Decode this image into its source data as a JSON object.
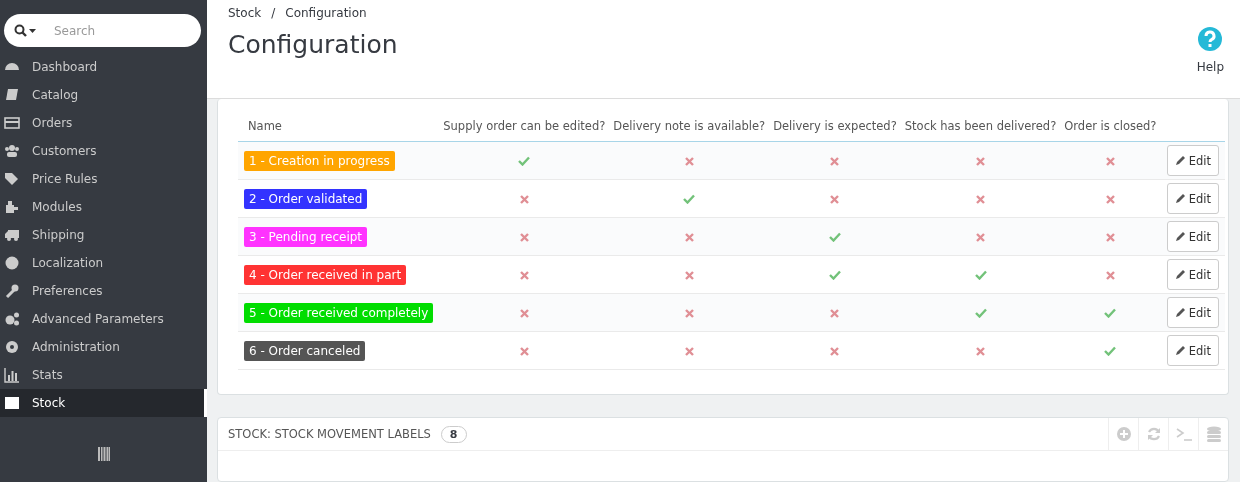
{
  "sidebar": {
    "search": {
      "placeholder": "Search"
    },
    "items": [
      {
        "label": "Dashboard",
        "selected": false
      },
      {
        "label": "Catalog",
        "selected": false
      },
      {
        "label": "Orders",
        "selected": false
      },
      {
        "label": "Customers",
        "selected": false
      },
      {
        "label": "Price Rules",
        "selected": false
      },
      {
        "label": "Modules",
        "selected": false
      },
      {
        "label": "Shipping",
        "selected": false
      },
      {
        "label": "Localization",
        "selected": false
      },
      {
        "label": "Preferences",
        "selected": false
      },
      {
        "label": "Advanced Parameters",
        "selected": false
      },
      {
        "label": "Administration",
        "selected": false
      },
      {
        "label": "Stats",
        "selected": false
      },
      {
        "label": "Stock",
        "selected": true
      }
    ]
  },
  "breadcrumb": [
    "Stock",
    "/",
    "Configuration"
  ],
  "page_title": "Configuration",
  "help": {
    "label": "Help"
  },
  "table": {
    "columns": [
      "Name",
      "Supply order can be edited?",
      "Delivery note is available?",
      "Delivery is expected?",
      "Stock has been delivered?",
      "Order is closed?"
    ],
    "rows": [
      {
        "name": "1 - Creation in progress",
        "color": "#ffa500",
        "values": [
          true,
          false,
          false,
          false,
          false
        ],
        "action": "Edit"
      },
      {
        "name": "2 - Order validated",
        "color": "#3333ff",
        "values": [
          false,
          true,
          false,
          false,
          false
        ],
        "action": "Edit"
      },
      {
        "name": "3 - Pending receipt",
        "color": "#ff33ff",
        "values": [
          false,
          false,
          true,
          false,
          false
        ],
        "action": "Edit"
      },
      {
        "name": "4 - Order received in part",
        "color": "#ff3333",
        "values": [
          false,
          false,
          true,
          true,
          false
        ],
        "action": "Edit"
      },
      {
        "name": "5 - Order received completely",
        "color": "#00dd00",
        "values": [
          false,
          false,
          false,
          true,
          true
        ],
        "action": "Edit"
      },
      {
        "name": "6 - Order canceled",
        "color": "#555555",
        "values": [
          false,
          false,
          false,
          false,
          true
        ],
        "action": "Edit"
      }
    ]
  },
  "movement_panel": {
    "title": "STOCK: STOCK MOVEMENT LABELS",
    "count": "8"
  }
}
